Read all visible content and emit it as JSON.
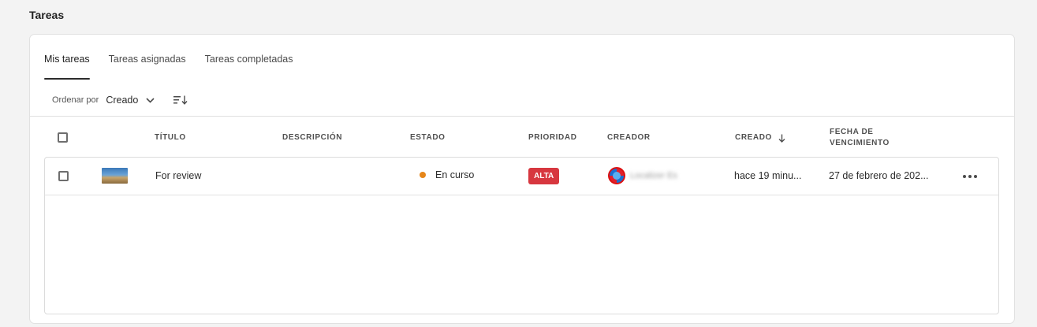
{
  "page": {
    "title": "Tareas"
  },
  "tabs": [
    {
      "label": "Mis tareas",
      "active": true
    },
    {
      "label": "Tareas asignadas",
      "active": false
    },
    {
      "label": "Tareas completadas",
      "active": false
    }
  ],
  "sort": {
    "label": "Ordenar por",
    "value": "Creado",
    "chevron_icon": "chevron-down-icon",
    "order_icon": "sort-descending-icon"
  },
  "table": {
    "headers": {
      "title": "TÍTULO",
      "description": "DESCRIPCIÓN",
      "status": "ESTADO",
      "priority": "PRIORIDAD",
      "creator": "CREADOR",
      "created": "CREADO",
      "due_line1": "FECHA DE",
      "due_line2": "VENCIMIENTO"
    },
    "rows": [
      {
        "title": "For review",
        "description": "",
        "status": "En curso",
        "status_color": "#e68619",
        "priority": "ALTA",
        "priority_color": "#d7373f",
        "creator": "Localizer Es",
        "created": "hace 19 minu...",
        "due": "27 de febrero de 202..."
      }
    ]
  }
}
